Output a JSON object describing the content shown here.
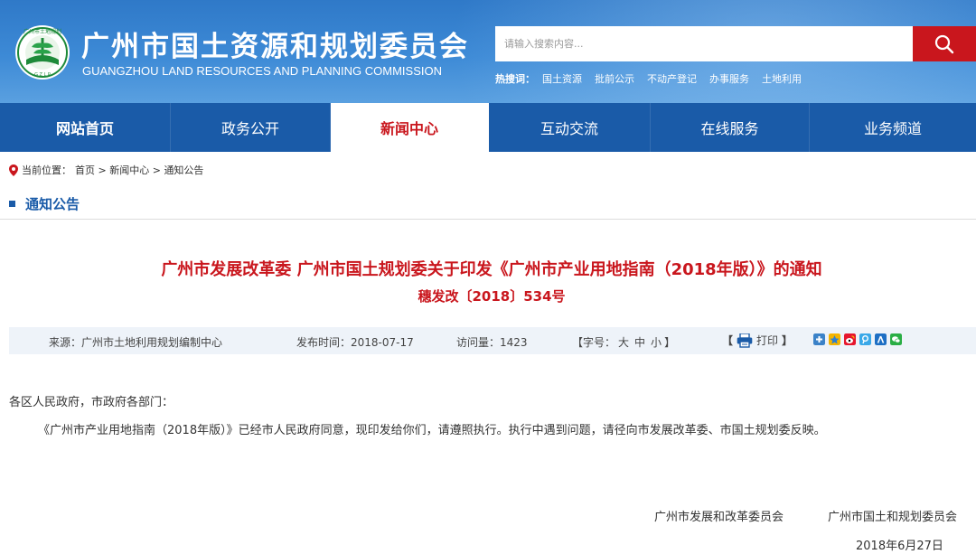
{
  "header": {
    "title": "广州市国土资源和规划委员会",
    "subtitle": "GUANGZHOU LAND RESOURCES AND PLANNING COMMISSION",
    "logo_text": "广州市土地规划 GZLP"
  },
  "search": {
    "placeholder": "请输入搜索内容...",
    "button_icon": "search-icon"
  },
  "hot_search": {
    "label": "热搜词：",
    "items": [
      "国土资源",
      "批前公示",
      "不动产登记",
      "办事服务",
      "土地利用"
    ]
  },
  "nav": {
    "items": [
      "网站首页",
      "政务公开",
      "新闻中心",
      "互动交流",
      "在线服务",
      "业务频道"
    ],
    "active": "新闻中心"
  },
  "breadcrumb": {
    "prefix": "当前位置：",
    "home": "首页",
    "sep1": " > ",
    "level1": "新闻中心",
    "sep2": " > ",
    "level2": "通知公告"
  },
  "section": {
    "title": "通知公告"
  },
  "article": {
    "title": "广州市发展改革委 广州市国土规划委关于印发《广州市产业用地指南（2018年版）》的通知",
    "doc_number": "穗发改〔2018〕534号",
    "source": "来源：广州市土地利用规划编制中心",
    "publish_date": "发布时间：2018-07-17",
    "visits": "访问量：1423",
    "font_size_label": "【字号：",
    "font_large": "大",
    "font_medium": "中",
    "font_small": "小",
    "font_size_end": "】",
    "print_open": "【",
    "print_label": "打印",
    "print_close": "】",
    "greeting": "各区人民政府，市政府各部门：",
    "paragraph": "《广州市产业用地指南（2018年版）》已经市人民政府同意，现印发给你们，请遵照执行。执行中遇到问题，请径向市发展改革委、市国土规划委反映。",
    "signer1": "广州市发展和改革委员会",
    "signer2": "广州市国土和规划委员会",
    "sign_date": "2018年6月27日"
  },
  "colors": {
    "header_blue": "#3d8ad6",
    "nav_blue": "#1a5ba8",
    "accent_red": "#c9161d"
  },
  "share_icons": [
    "plus-share-icon",
    "qzone-icon",
    "weibo-icon",
    "tencent-weibo-icon",
    "renren-icon",
    "wechat-icon"
  ]
}
